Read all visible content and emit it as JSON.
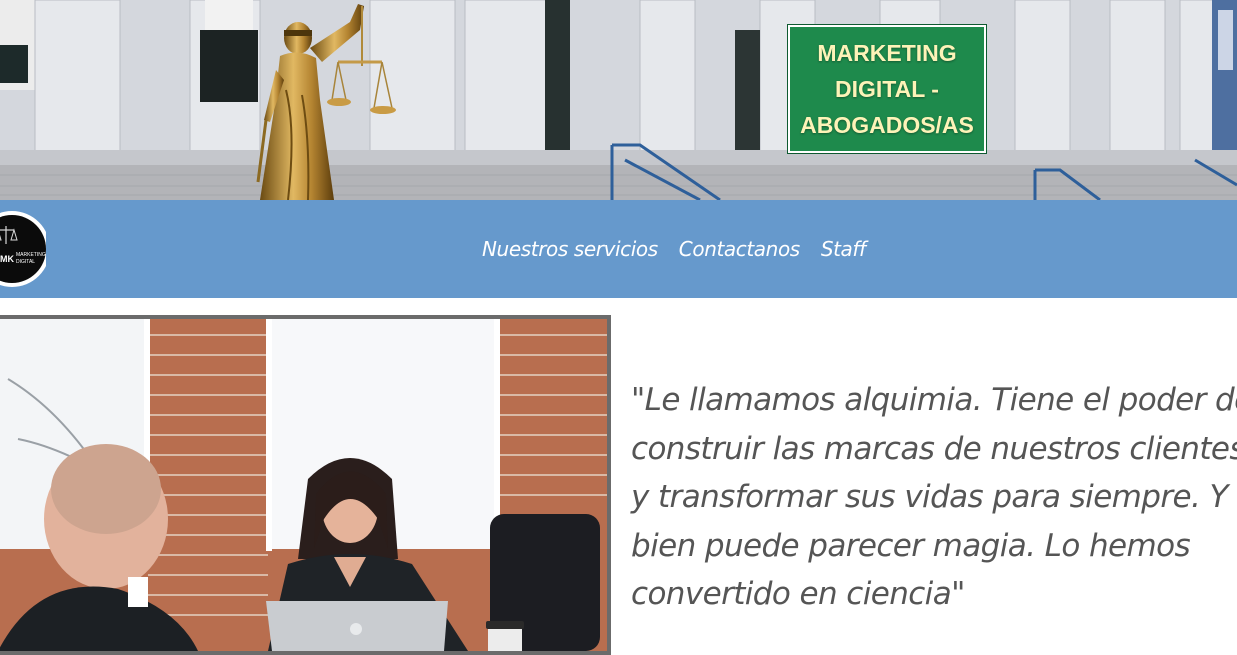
{
  "hero": {
    "badge_text": "MARKETING DIGITAL - ABOGADOS/AS",
    "statue_icon": "lady-justice-statue"
  },
  "nav": {
    "logo_icon": "scales-logo",
    "logo_text": "MK MARKETING DIGITAL",
    "links": [
      {
        "label": "Nuestros servicios"
      },
      {
        "label": "Contactanos"
      },
      {
        "label": "Staff"
      }
    ]
  },
  "content": {
    "quote": "\"Le llamamos alquimia. Tiene el poder de construir las marcas de nuestros clientes y transformar sus vidas para siempre. Y si bien puede parecer magia. Lo hemos convertido en ciencia\""
  },
  "colors": {
    "nav_bg": "#6699cc",
    "badge_bg": "#1e8a4c",
    "badge_text": "#fdf3b8",
    "quote_text": "#555555"
  }
}
